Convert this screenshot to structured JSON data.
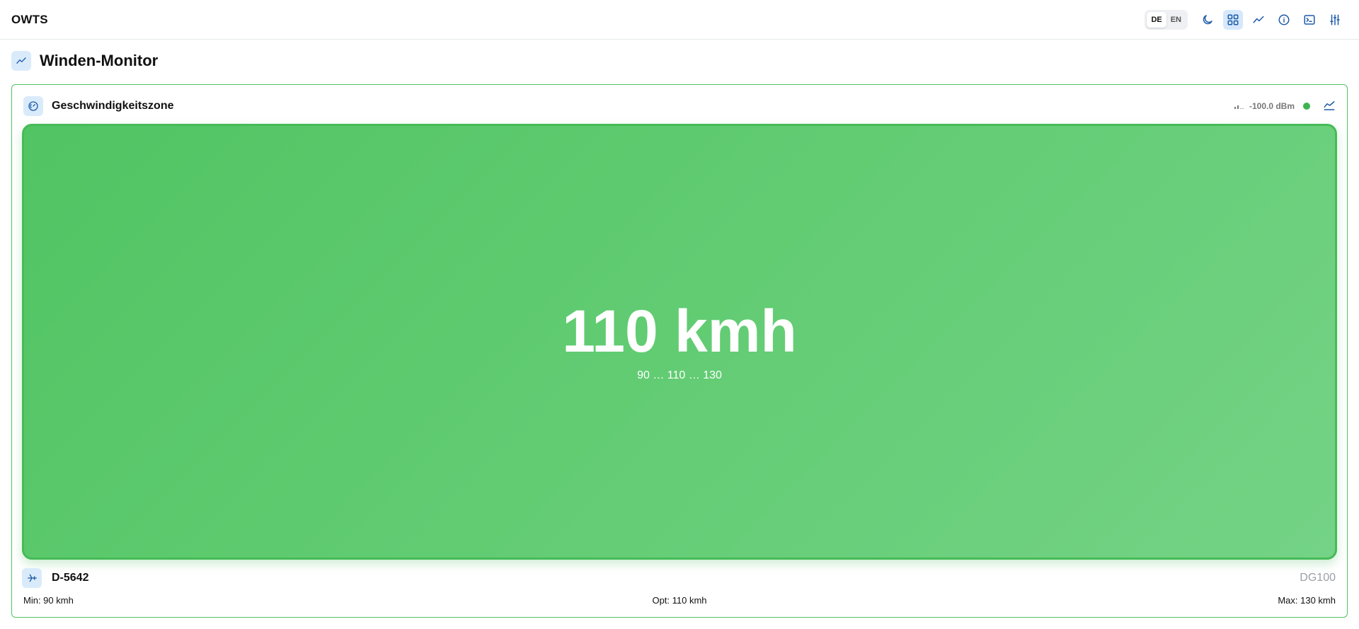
{
  "app": {
    "title": "OWTS"
  },
  "toolbar": {
    "languages": [
      "DE",
      "EN"
    ],
    "active_language": "DE",
    "buttons": [
      "moon-icon",
      "dashboard-icon",
      "trend-icon",
      "info-icon",
      "terminal-icon",
      "sliders-icon"
    ],
    "active_button": "dashboard-icon"
  },
  "page": {
    "title": "Winden-Monitor",
    "icon": "trend-icon"
  },
  "card": {
    "title": "Geschwindigkeitszone",
    "icon": "gauge-icon",
    "signal": "-100.0 dBm",
    "status_color": "#3db44f",
    "border_color": "#4fc361"
  },
  "zone": {
    "speed": "110 kmh",
    "range": "90 … 110 … 130",
    "color": "#5ac76b"
  },
  "glider": {
    "registration": "D-5642",
    "type": "DG100",
    "icon": "glider-icon"
  },
  "limits": {
    "min": "Min: 90 kmh",
    "opt": "Opt: 110 kmh",
    "max": "Max: 130 kmh"
  }
}
